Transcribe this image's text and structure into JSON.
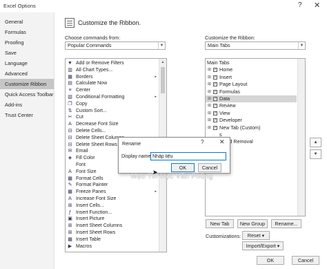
{
  "window": {
    "title": "Excel Options",
    "help_icon": "?",
    "close_icon": "✕"
  },
  "sidebar": {
    "items": [
      {
        "label": "General"
      },
      {
        "label": "Formulas"
      },
      {
        "label": "Proofing"
      },
      {
        "label": "Save"
      },
      {
        "label": "Language"
      },
      {
        "label": "Advanced"
      },
      {
        "label": "Customize Ribbon",
        "selected": true
      },
      {
        "label": "Quick Access Toolbar"
      },
      {
        "label": "Add-ins"
      },
      {
        "label": "Trust Center"
      }
    ]
  },
  "header": {
    "title": "Customize the Ribbon."
  },
  "left_panel": {
    "label": "Choose commands from:",
    "combo_value": "Popular Commands",
    "commands": [
      {
        "label": "Add or Remove Filters",
        "icon": "filter-icon",
        "glyph": "▼"
      },
      {
        "label": "All Chart Types...",
        "icon": "chart-icon",
        "glyph": "▥"
      },
      {
        "label": "Borders",
        "icon": "borders-icon",
        "glyph": "▦",
        "sub": "▸"
      },
      {
        "label": "Calculate Now",
        "icon": "calculator-icon",
        "glyph": "▤"
      },
      {
        "label": "Center",
        "icon": "align-center-icon",
        "glyph": "≡"
      },
      {
        "label": "Conditional Formatting",
        "icon": "conditional-format-icon",
        "glyph": "▧",
        "sub": "▸"
      },
      {
        "label": "Copy",
        "icon": "copy-icon",
        "glyph": "❐"
      },
      {
        "label": "Custom Sort...",
        "icon": "sort-icon",
        "glyph": "⇅"
      },
      {
        "label": "Cut",
        "icon": "cut-icon",
        "glyph": "✂"
      },
      {
        "label": "Decrease Font Size",
        "icon": "font-decrease-icon",
        "glyph": "A"
      },
      {
        "label": "Delete Cells...",
        "icon": "delete-cells-icon",
        "glyph": "⊟"
      },
      {
        "label": "Delete Sheet Columns",
        "icon": "delete-columns-icon",
        "glyph": "⊟"
      },
      {
        "label": "Delete Sheet Rows",
        "icon": "delete-rows-icon",
        "glyph": "⊟"
      },
      {
        "label": "Email",
        "icon": "email-icon",
        "glyph": "✉"
      },
      {
        "label": "Fill Color",
        "icon": "fill-color-icon",
        "glyph": "◈"
      },
      {
        "label": "Font",
        "icon": "font-icon",
        "glyph": ""
      },
      {
        "label": "Font Size",
        "icon": "font-size-icon",
        "glyph": "A"
      },
      {
        "label": "Format Cells",
        "icon": "format-cells-icon",
        "glyph": "▦"
      },
      {
        "label": "Format Painter",
        "icon": "format-painter-icon",
        "glyph": "✎"
      },
      {
        "label": "Freeze Panes",
        "icon": "freeze-panes-icon",
        "glyph": "▦",
        "sub": "▸"
      },
      {
        "label": "Increase Font Size",
        "icon": "font-increase-icon",
        "glyph": "A"
      },
      {
        "label": "Insert Cells...",
        "icon": "insert-cells-icon",
        "glyph": "⊞"
      },
      {
        "label": "Insert Function...",
        "icon": "function-icon",
        "glyph": "ƒ"
      },
      {
        "label": "Insert Picture",
        "icon": "picture-icon",
        "glyph": "▣"
      },
      {
        "label": "Insert Sheet Columns",
        "icon": "insert-columns-icon",
        "glyph": "⊞"
      },
      {
        "label": "Insert Sheet Rows",
        "icon": "insert-rows-icon",
        "glyph": "⊞"
      },
      {
        "label": "Insert Table",
        "icon": "table-icon",
        "glyph": "▦"
      },
      {
        "label": "Macros",
        "icon": "macro-icon",
        "glyph": "▶"
      }
    ]
  },
  "right_panel": {
    "label": "Customize the Ribbon:",
    "combo_value": "Main Tabs",
    "tree": [
      {
        "label": "Main Tabs",
        "head": true
      },
      {
        "label": "Home",
        "expander": "⊞",
        "checked": true
      },
      {
        "label": "Insert",
        "expander": "⊞",
        "checked": true
      },
      {
        "label": "Page Layout",
        "expander": "⊞",
        "checked": true
      },
      {
        "label": "Formulas",
        "expander": "⊞",
        "checked": true
      },
      {
        "label": "Data",
        "expander": "⊞",
        "checked": true,
        "selected": true
      },
      {
        "label": "Review",
        "expander": "⊞",
        "checked": true
      },
      {
        "label": "View",
        "expander": "⊞",
        "checked": true
      },
      {
        "label": "Developer",
        "expander": "⊞",
        "checked": true
      },
      {
        "label": "New Tab (Custom)",
        "expander": "⊞",
        "checked": true
      },
      {
        "label": "s",
        "expander": "",
        "checked": false
      },
      {
        "label": "round Removal",
        "expander": "",
        "checked": false
      }
    ],
    "new_tab_label": "New Tab",
    "new_group_label": "New Group",
    "rename_label": "Rename...",
    "customizations_label": "Customizations:",
    "reset_label": "Reset ▾",
    "import_export_label": "Import/Export ▾"
  },
  "dialog": {
    "title": "Rename",
    "help": "?",
    "close": "✕",
    "display_name_label": "Display name:",
    "display_name_value": "Nhập liệu",
    "ok_label": "OK",
    "cancel_label": "Cancel"
  },
  "watermark": "Mẹo Tin Học Văn Phòng",
  "footer": {
    "ok_label": "OK",
    "cancel_label": "Cancel"
  },
  "arrows": {
    "up": "▲",
    "down": "▼",
    "dropdown": "▼"
  }
}
